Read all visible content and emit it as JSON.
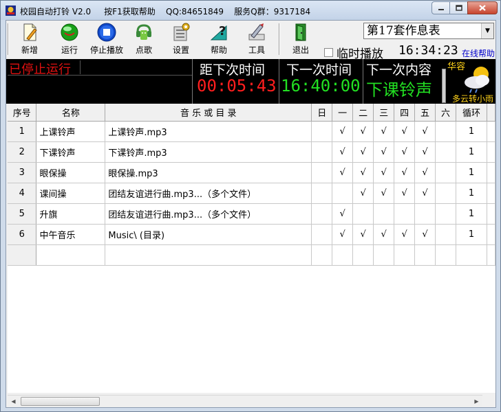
{
  "window": {
    "title": "校园自动打铃 V2.0",
    "f1_hint": "按F1获取帮助",
    "qq": "QQ:84651849",
    "service_qq": "服务Q群：9317184"
  },
  "toolbar": {
    "buttons": [
      {
        "label": "新增",
        "icon": "new-document-icon"
      },
      {
        "label": "运行",
        "icon": "run-green-ball-icon"
      },
      {
        "label": "停止播放",
        "icon": "stop-icon"
      },
      {
        "label": "点歌",
        "icon": "android-music-icon"
      },
      {
        "label": "设置",
        "icon": "settings-gear-icon"
      },
      {
        "label": "帮助",
        "icon": "help-question-icon"
      },
      {
        "label": "工具",
        "icon": "tools-icon"
      },
      {
        "label": "退出",
        "icon": "exit-door-icon"
      }
    ],
    "schedule_selected": "第17套作息表",
    "temp_play_label": "临时播放",
    "clock": "16:34:23",
    "online_help": "在线帮助"
  },
  "status": {
    "run_state": "已停止运行",
    "countdown_title": "距下次时间",
    "countdown_value": "00:05:43",
    "next_time_title": "下一次时间",
    "next_time_value": "16:40:00",
    "next_content_title": "下一次内容",
    "next_content_value": "下课铃声",
    "weather_city": "华容",
    "weather_desc": "多云转小雨",
    "colors": {
      "stop": "#e01010",
      "countdown": "#ff1e1e",
      "next": "#22e022"
    }
  },
  "table": {
    "headers": [
      "序号",
      "名称",
      "音 乐 或 目 录",
      "日",
      "一",
      "二",
      "三",
      "四",
      "五",
      "六",
      "循环"
    ],
    "check_mark": "√",
    "rows": [
      {
        "no": "1",
        "name": "上课铃声",
        "music": "上课铃声.mp3",
        "days": [
          "",
          "√",
          "√",
          "√",
          "√",
          "√",
          ""
        ],
        "loop": "1"
      },
      {
        "no": "2",
        "name": "下课铃声",
        "music": "下课铃声.mp3",
        "days": [
          "",
          "√",
          "√",
          "√",
          "√",
          "√",
          ""
        ],
        "loop": "1"
      },
      {
        "no": "3",
        "name": "眼保操",
        "music": "眼保操.mp3",
        "days": [
          "",
          "√",
          "√",
          "√",
          "√",
          "√",
          ""
        ],
        "loop": "1"
      },
      {
        "no": "4",
        "name": "课间操",
        "music": "团结友谊进行曲.mp3...（多个文件）",
        "days": [
          "",
          "",
          "√",
          "√",
          "√",
          "√",
          ""
        ],
        "loop": "1"
      },
      {
        "no": "5",
        "name": "升旗",
        "music": "团结友谊进行曲.mp3...（多个文件）",
        "days": [
          "",
          "√",
          "",
          "",
          "",
          "",
          ""
        ],
        "loop": "1"
      },
      {
        "no": "6",
        "name": "中午音乐",
        "music": "Music\\ (目录)",
        "days": [
          "",
          "√",
          "√",
          "√",
          "√",
          "√",
          ""
        ],
        "loop": "1"
      },
      {
        "no": "",
        "name": "",
        "music": "",
        "days": [
          "",
          "",
          "",
          "",
          "",
          "",
          ""
        ],
        "loop": ""
      }
    ]
  }
}
